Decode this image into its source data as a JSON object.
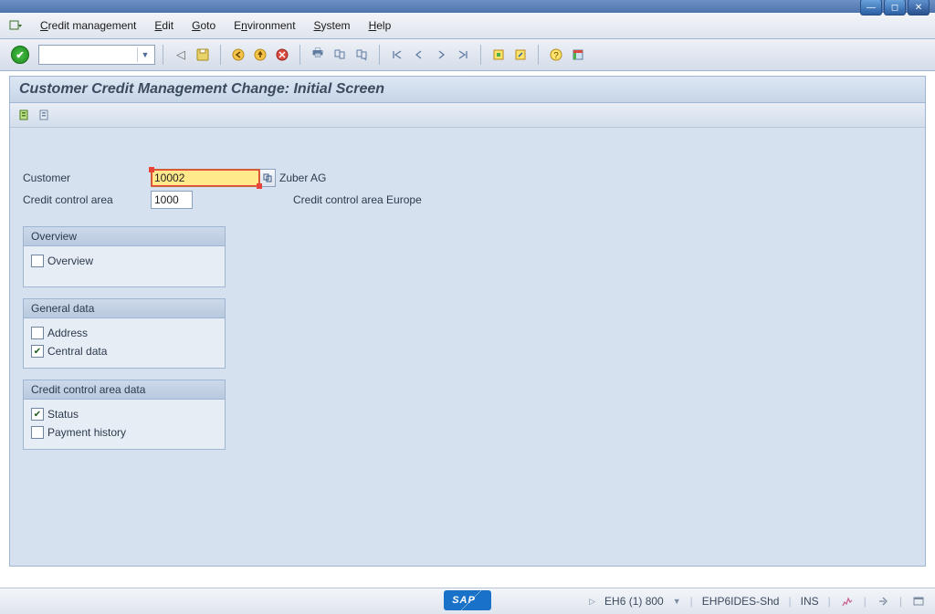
{
  "menu": {
    "items": [
      "Credit management",
      "Edit",
      "Goto",
      "Environment",
      "System",
      "Help"
    ],
    "underlines": [
      "C",
      "E",
      "G",
      "n",
      "S",
      "H"
    ]
  },
  "toolbar": {
    "combo_value": ""
  },
  "transaction": {
    "title": "Customer Credit Management Change: Initial Screen"
  },
  "form": {
    "customer_label": "Customer",
    "customer_value": "10002",
    "customer_desc": "Zuber AG",
    "cca_label": "Credit control area",
    "cca_value": "1000",
    "cca_desc": "Credit control area Europe"
  },
  "groups": {
    "overview": {
      "title": "Overview",
      "items": [
        {
          "label": "Overview",
          "checked": false
        }
      ]
    },
    "general": {
      "title": "General data",
      "items": [
        {
          "label": "Address",
          "checked": false
        },
        {
          "label": "Central data",
          "checked": true
        }
      ]
    },
    "cca": {
      "title": "Credit control area data",
      "items": [
        {
          "label": "Status",
          "checked": true
        },
        {
          "label": "Payment history",
          "checked": false
        }
      ]
    }
  },
  "status": {
    "system": "EH6 (1) 800",
    "server": "EHP6IDES-Shd",
    "mode": "INS"
  }
}
